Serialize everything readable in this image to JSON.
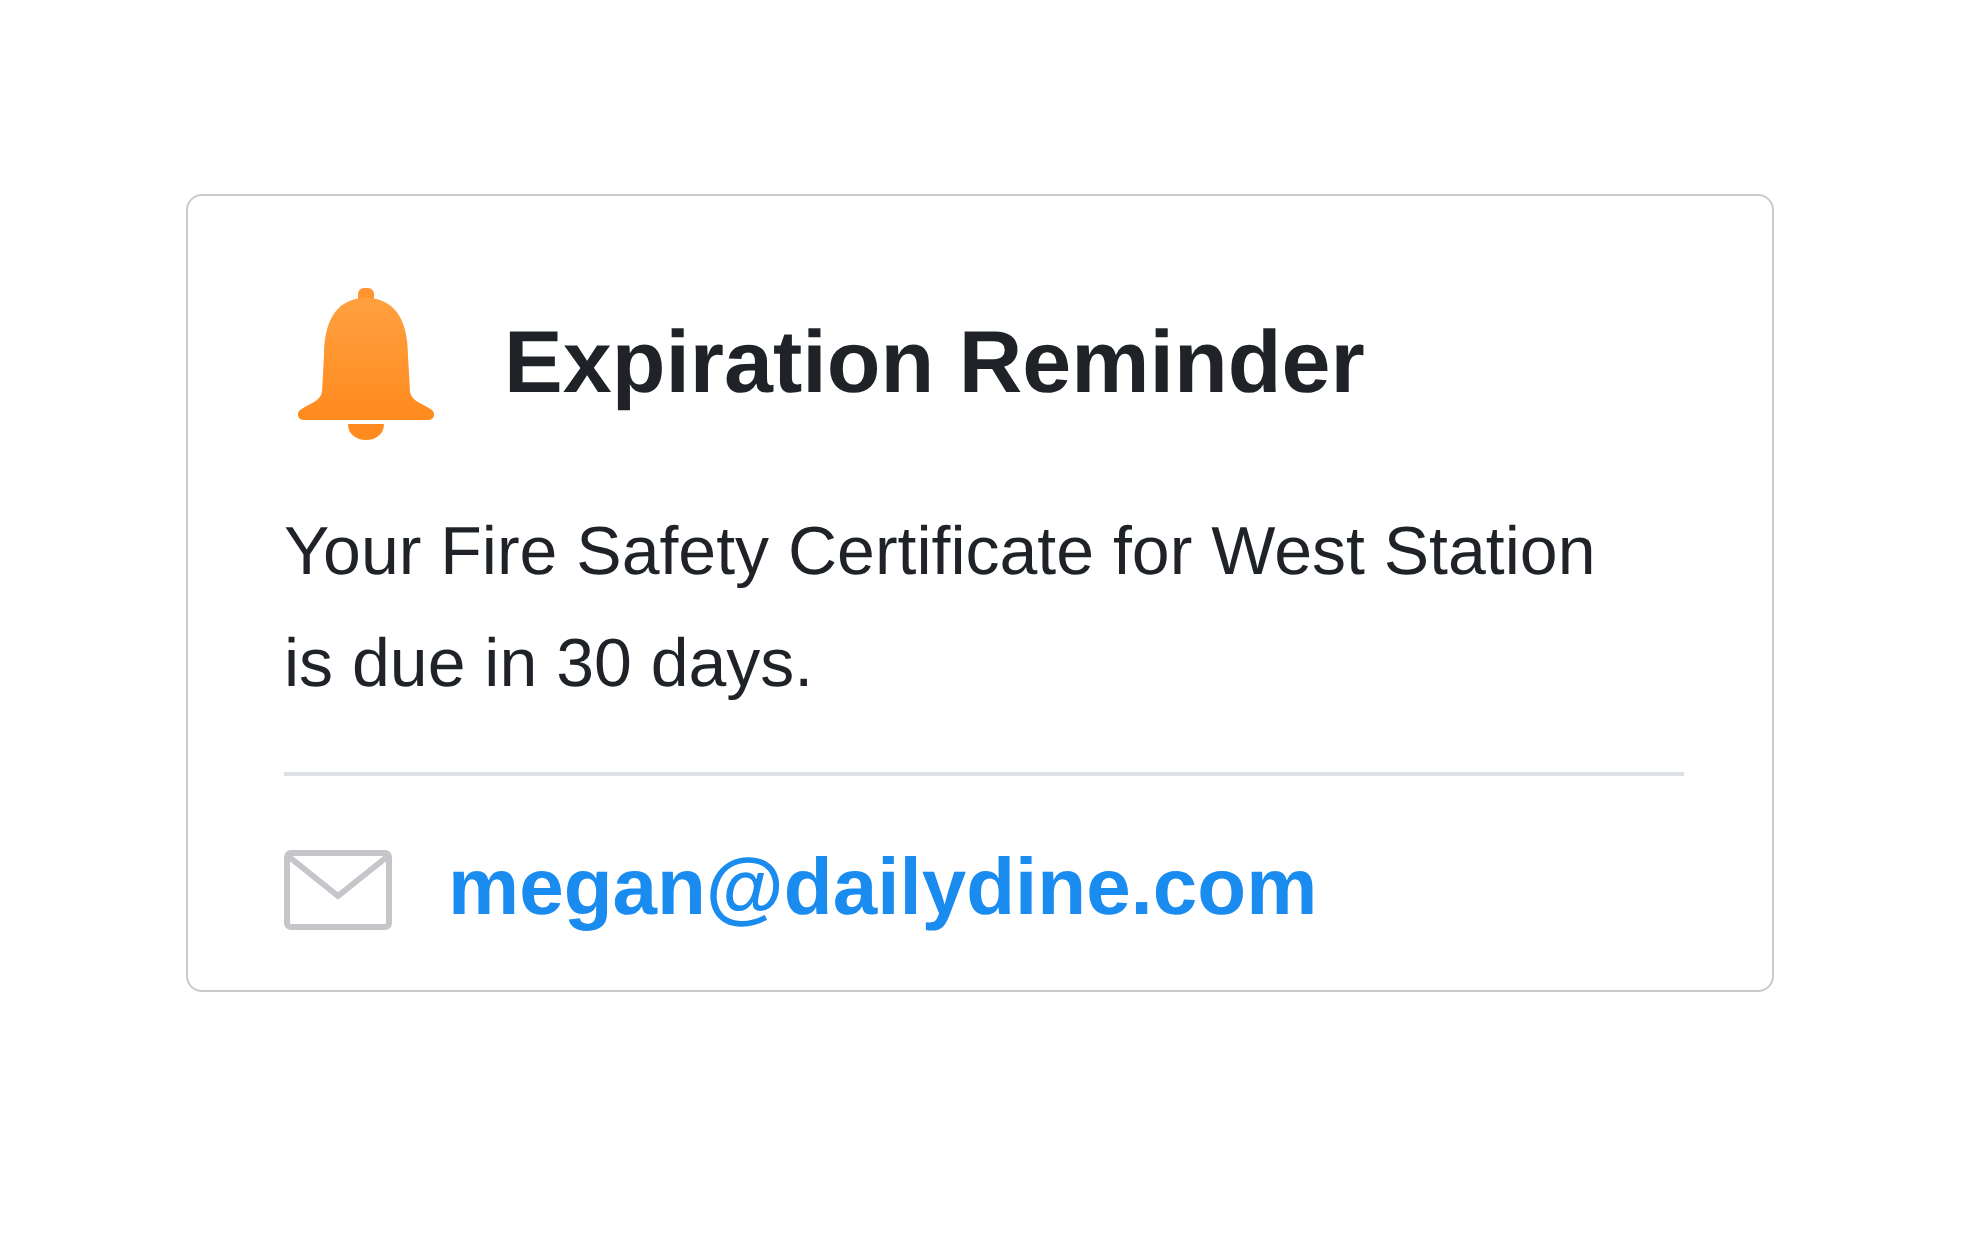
{
  "reminder": {
    "title": "Expiration Reminder",
    "message": "Your Fire Safety Certificate for West Station is due in 30 days.",
    "email": "megan@dailydine.com"
  }
}
